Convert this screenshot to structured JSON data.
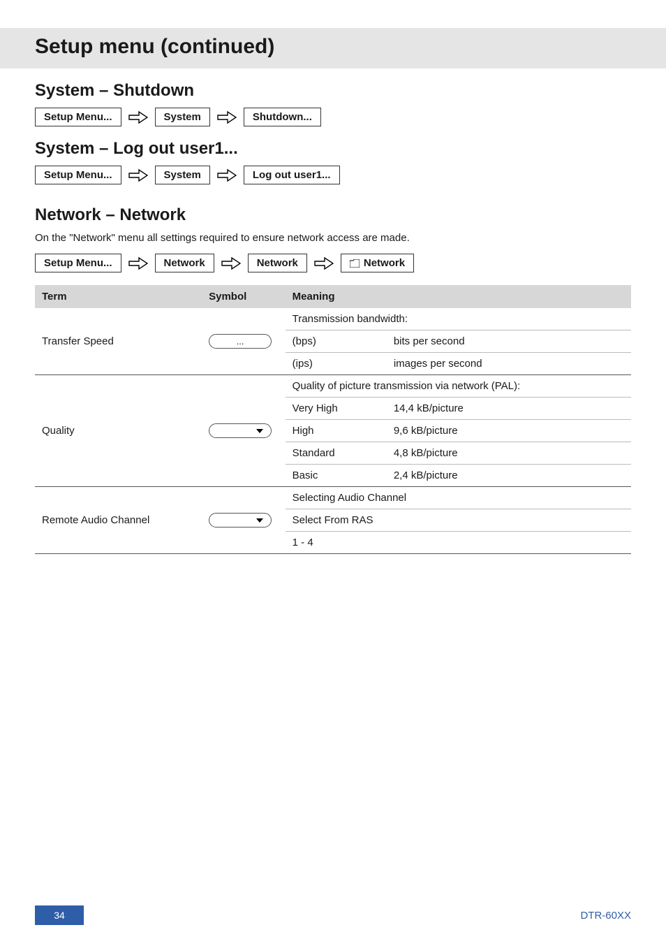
{
  "title": "Setup menu (continued)",
  "sections": {
    "shutdown": {
      "heading": "System – Shutdown",
      "crumbs": [
        "Setup Menu...",
        "System",
        "Shutdown..."
      ]
    },
    "logout": {
      "heading": "System – Log out user1...",
      "crumbs": [
        "Setup Menu...",
        "System",
        "Log out user1..."
      ]
    },
    "network": {
      "heading": "Network – Network",
      "intro": "On the \"Network\" menu all settings required to ensure network access are made.",
      "crumbs": [
        "Setup Menu...",
        "Network",
        "Network"
      ],
      "tab": "Network"
    }
  },
  "table": {
    "headers": {
      "term": "Term",
      "symbol": "Symbol",
      "meaning": "Meaning"
    },
    "rows": {
      "transfer": {
        "term": "Transfer Speed",
        "symbol": "...",
        "meaningHeader": "Transmission bandwidth:",
        "sub": [
          {
            "k": "(bps)",
            "v": "bits per second"
          },
          {
            "k": "(ips)",
            "v": "images per second"
          }
        ]
      },
      "quality": {
        "term": "Quality",
        "meaningHeader": "Quality of picture transmission via network (PAL):",
        "sub": [
          {
            "k": "Very High",
            "v": "14,4 kB/picture"
          },
          {
            "k": "High",
            "v": "9,6 kB/picture"
          },
          {
            "k": "Standard",
            "v": "4,8 kB/picture"
          },
          {
            "k": "Basic",
            "v": "2,4 kB/picture"
          }
        ]
      },
      "audio": {
        "term": "Remote Audio Channel",
        "sub": [
          {
            "k": "Selecting Audio Channel"
          },
          {
            "k": "Select From RAS"
          },
          {
            "k": "1 - 4"
          }
        ]
      }
    }
  },
  "footer": {
    "page": "34",
    "model": "DTR-60XX"
  }
}
